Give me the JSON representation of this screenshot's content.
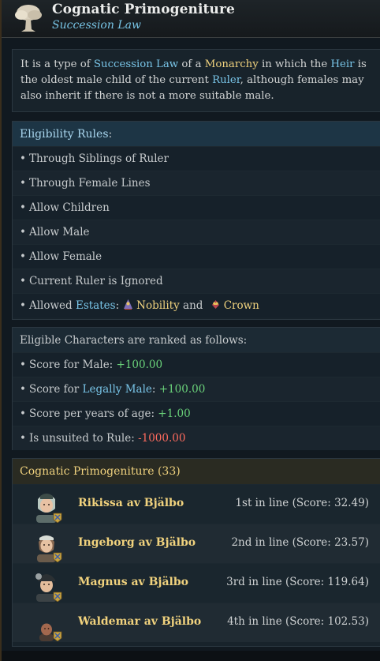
{
  "header": {
    "title": "Cognatic Primogeniture",
    "subtitle": "Succession Law",
    "icon": "tree-icon"
  },
  "description": {
    "p1": "It is a type of ",
    "kw_succession": "Succession Law",
    "p2": " of a ",
    "kw_monarchy": "Monarchy",
    "p3": " in which the ",
    "kw_heir": "Heir",
    "p4": " is the oldest male child of the current ",
    "kw_ruler": "Ruler",
    "p5": ", although females may also inherit if there is not a more suitable male."
  },
  "eligibility": {
    "heading": "Eligibility Rules",
    "heading_colon": ":",
    "rules": [
      "Through Siblings of Ruler",
      "Through Female Lines",
      "Allow Children",
      "Allow Male",
      "Allow Female",
      "Current Ruler is Ignored"
    ],
    "estates_prefix": "Allowed ",
    "estates_kw": "Estates",
    "estates_colon": ":",
    "estate_1": "Nobility",
    "estates_and": " and ",
    "estate_2": "Crown"
  },
  "ranking": {
    "heading": "Eligible Characters are ranked as follows:",
    "score_male_label": "Score for Male: ",
    "score_male_value": "+100.00",
    "score_legal_prefix": "Score for ",
    "score_legal_kw": "Legally Male",
    "score_legal_colon": ": ",
    "score_legal_value": "+100.00",
    "score_age_label": "Score per years of age: ",
    "score_age_value": "+1.00",
    "unsuited_label": "Is unsuited to Rule: ",
    "unsuited_value": "-1000.00"
  },
  "line_of_succession": {
    "heading": "Cognatic Primogeniture (33)",
    "characters": [
      {
        "name": "Rikissa",
        "house": "av Bjälbo",
        "rank": "1st in line (Score: 32.49)"
      },
      {
        "name": "Ingeborg",
        "house": "av Bjälbo",
        "rank": "2nd in line (Score: 23.57)"
      },
      {
        "name": "Magnus",
        "house": "av Bjälbo",
        "rank": "3rd in line (Score: 119.64)"
      },
      {
        "name": "Waldemar",
        "house": "av Bjälbo",
        "rank": "4th in line (Score: 102.53)"
      }
    ]
  },
  "colors": {
    "keyword_blue": "#79c5e8",
    "keyword_gold": "#f0d27e",
    "positive": "#6ad27a",
    "negative": "#ff6b5e"
  }
}
